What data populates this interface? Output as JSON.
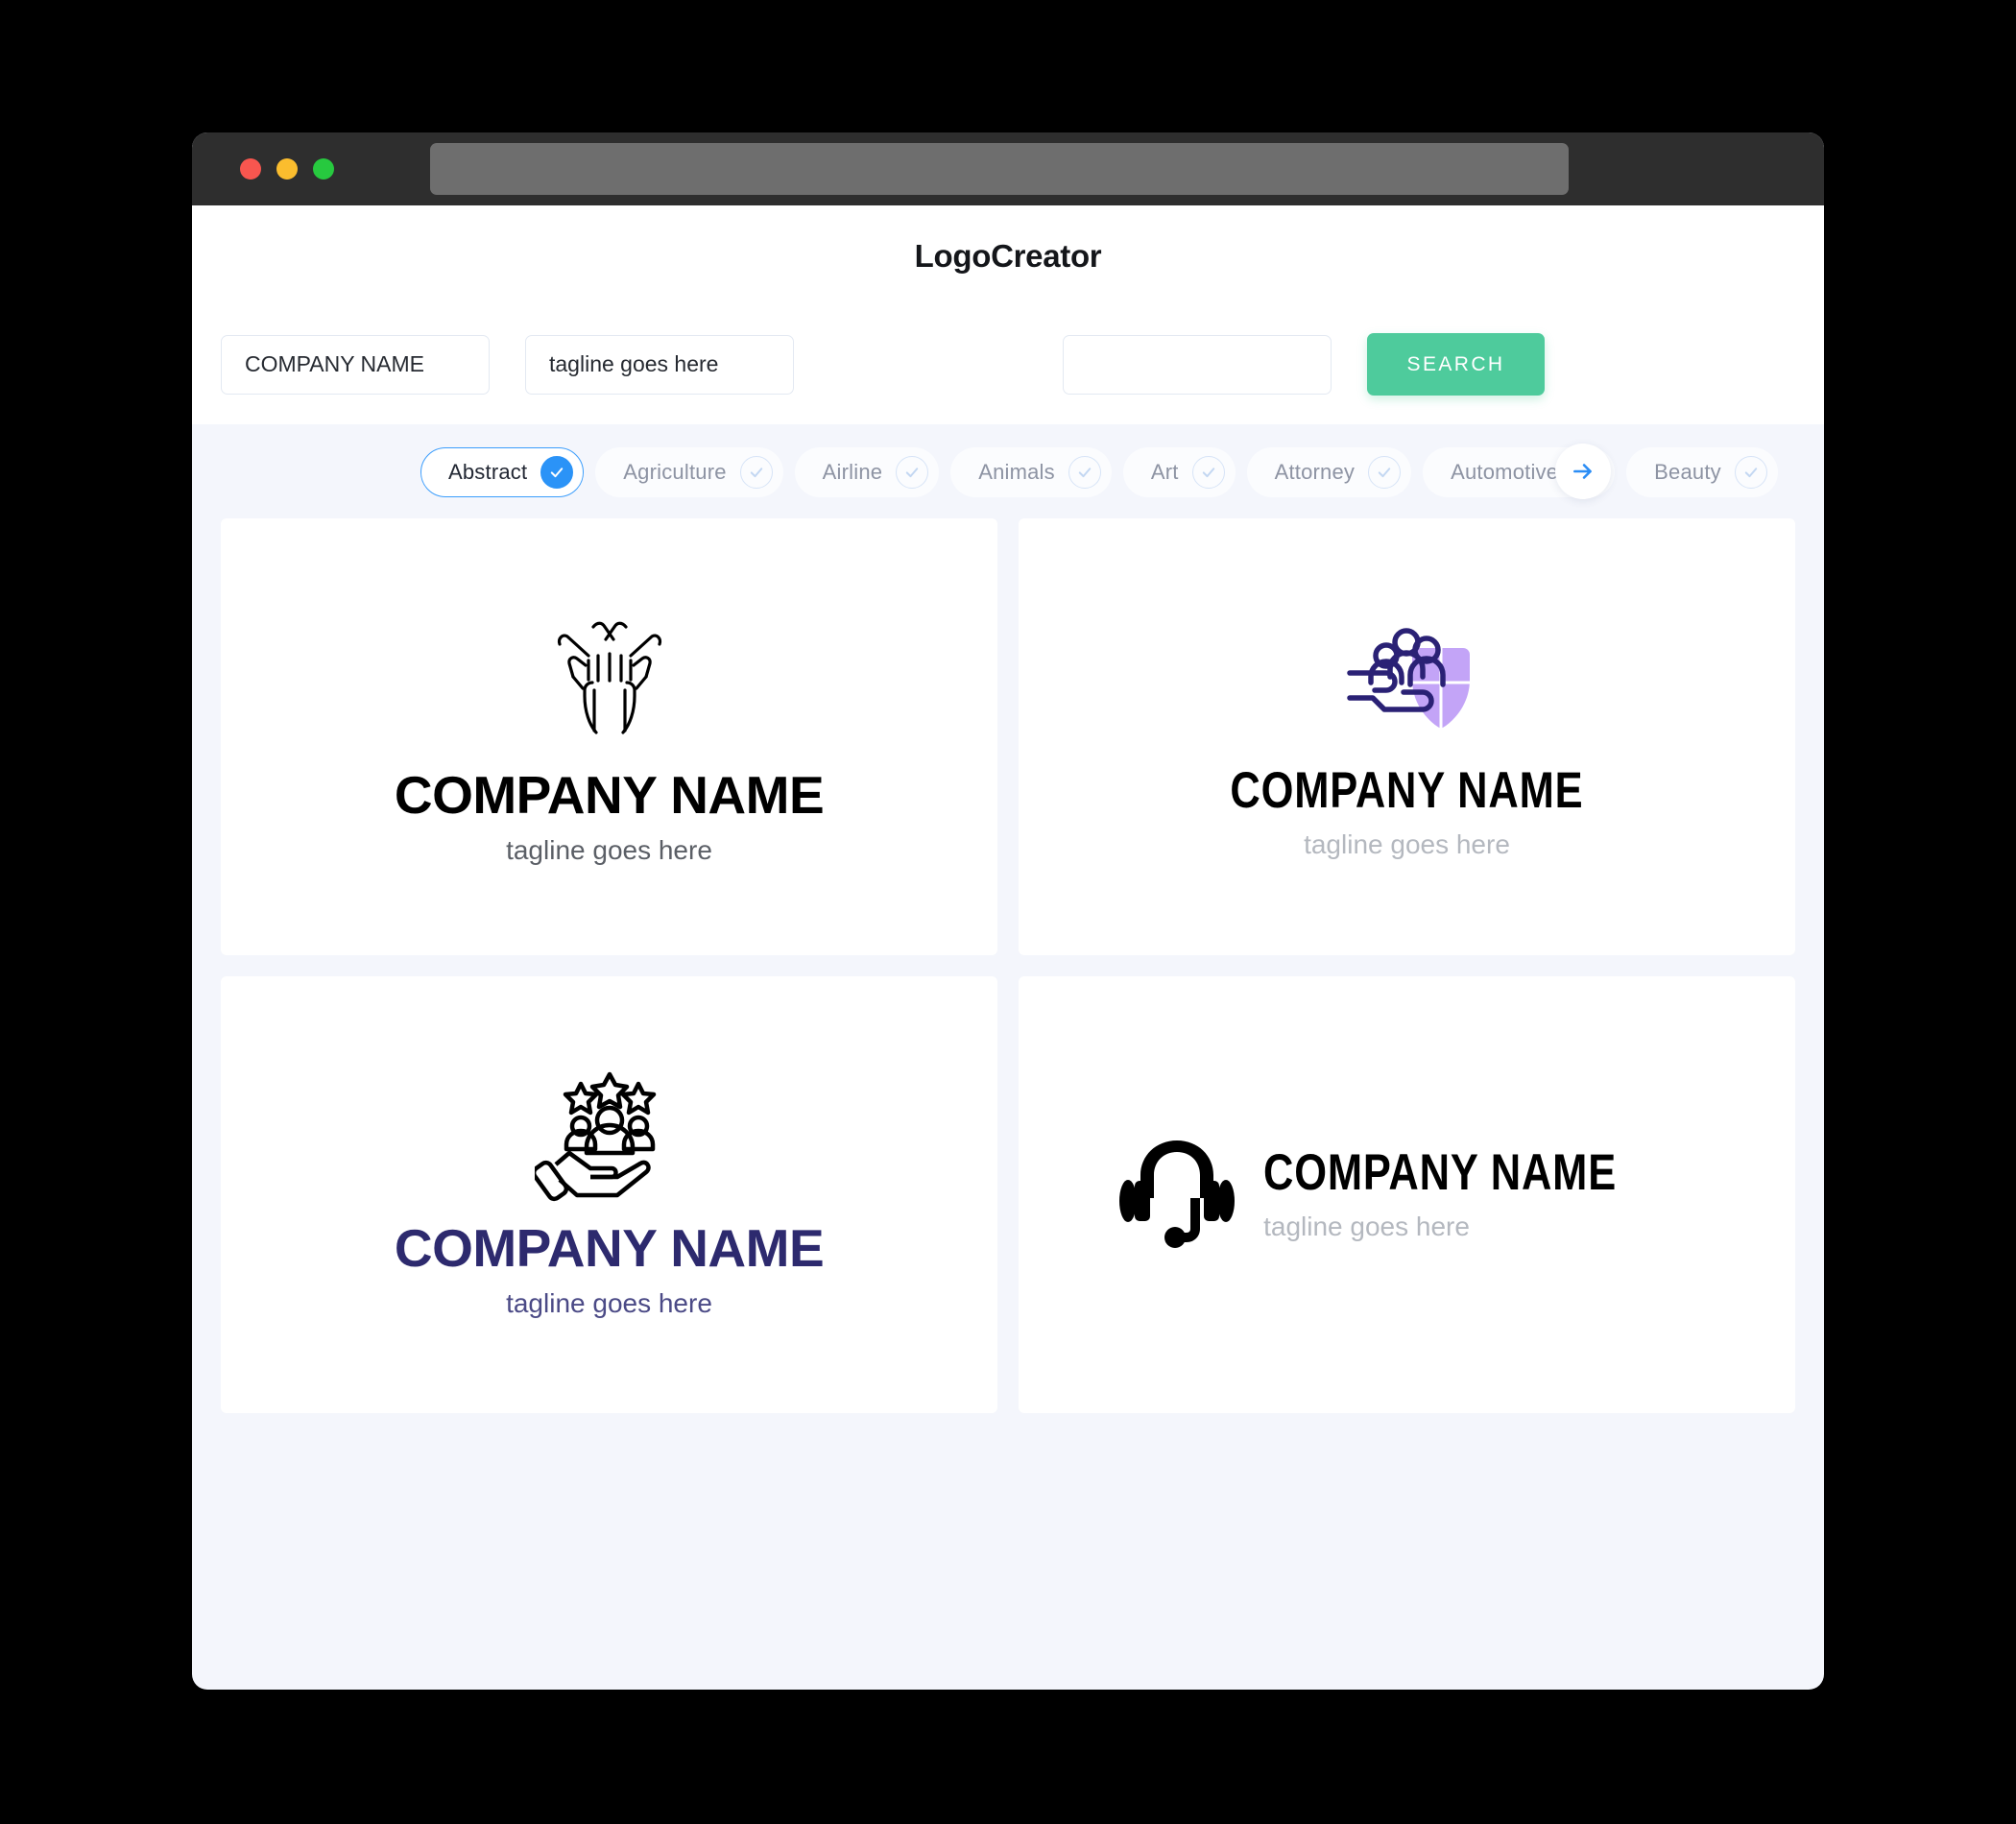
{
  "window": {
    "traffic_lights": [
      "close",
      "minimize",
      "maximize"
    ],
    "url_value": ""
  },
  "header": {
    "title": "LogoCreator"
  },
  "search": {
    "company_value": "COMPANY NAME",
    "company_placeholder": "COMPANY NAME",
    "tagline_value": "tagline goes here",
    "tagline_placeholder": "tagline goes here",
    "extra_value": "",
    "extra_placeholder": "",
    "search_label": "SEARCH",
    "search_color": "#4ecb9c"
  },
  "categories": {
    "next_icon": "arrow-right-icon",
    "accent_color": "#2b93f7",
    "items": [
      {
        "label": "Abstract",
        "selected": true
      },
      {
        "label": "Agriculture",
        "selected": false
      },
      {
        "label": "Airline",
        "selected": false
      },
      {
        "label": "Animals",
        "selected": false
      },
      {
        "label": "Art",
        "selected": false
      },
      {
        "label": "Attorney",
        "selected": false
      },
      {
        "label": "Automotive",
        "selected": false
      },
      {
        "label": "Beauty",
        "selected": false
      }
    ]
  },
  "results": {
    "cards": [
      {
        "icon": "hands-together-icon",
        "name": "COMPANY NAME",
        "tagline": "tagline goes here",
        "name_color": "#000000",
        "tagline_color": "#5b5f66"
      },
      {
        "icon": "shield-people-hand-icon",
        "name": "COMPANY NAME",
        "tagline": "tagline goes here",
        "name_color": "#000000",
        "tagline_color": "#b4b8bf"
      },
      {
        "icon": "hand-people-stars-icon",
        "name": "COMPANY NAME",
        "tagline": "tagline goes here",
        "name_color": "#2d2a6e",
        "tagline_color": "#4b4a86"
      },
      {
        "icon": "headset-icon",
        "name": "COMPANY NAME",
        "tagline": "tagline goes here",
        "name_color": "#000000",
        "tagline_color": "#b4b8bf"
      }
    ]
  }
}
